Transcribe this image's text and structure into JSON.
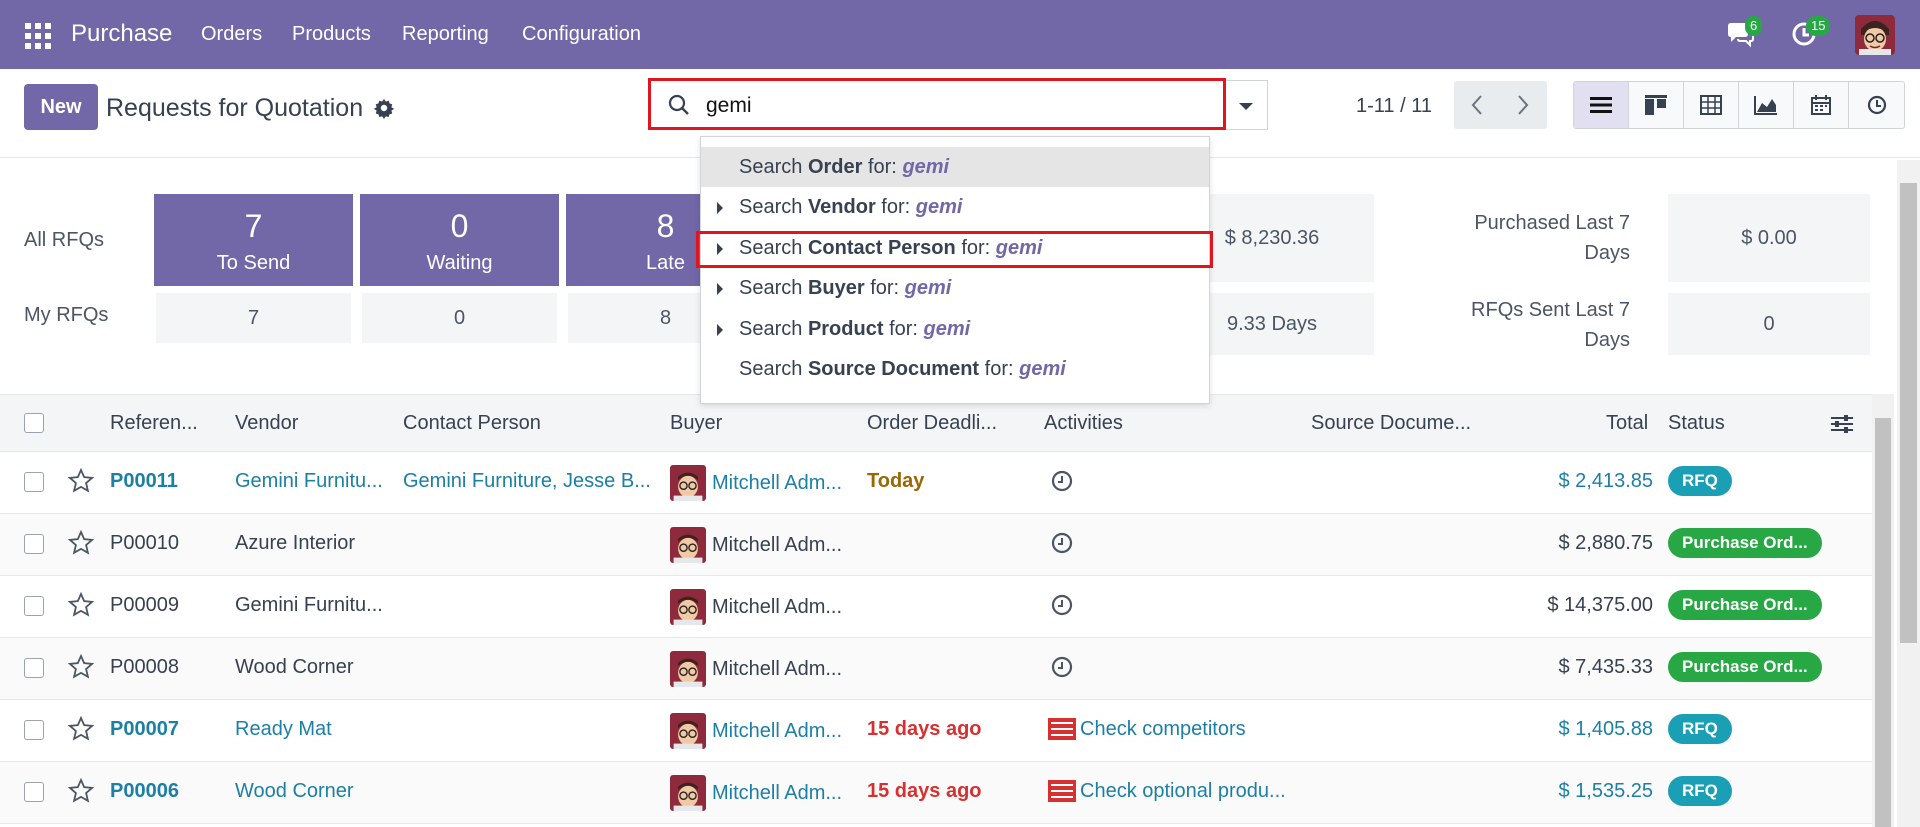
{
  "topbar": {
    "brand": "Purchase",
    "menu": [
      "Orders",
      "Products",
      "Reporting",
      "Configuration"
    ],
    "messages_count": "6",
    "activities_count": "15"
  },
  "control": {
    "new_label": "New",
    "title": "Requests for Quotation",
    "search_value": "gemi",
    "pager": "1-11 / 11"
  },
  "dashboard": {
    "row_all_label": "All RFQs",
    "row_my_label": "My RFQs",
    "tiles": [
      {
        "num": "7",
        "label": "To Send",
        "my": "7"
      },
      {
        "num": "0",
        "label": "Waiting",
        "my": "0"
      },
      {
        "num": "8",
        "label": "Late",
        "my": "8"
      }
    ],
    "stat_value_1": "$ 8,230.36",
    "stat_value_2": "9.33 Days",
    "purchased_label": "Purchased Last 7 Days",
    "purchased_value": "$ 0.00",
    "rfq_sent_label": "RFQs Sent Last 7 Days",
    "rfq_sent_value": "0"
  },
  "search_dropdown": {
    "prefix": "Search",
    "for": "for:",
    "query": "gemi",
    "items": [
      {
        "field": "Order",
        "expandable": false
      },
      {
        "field": "Vendor",
        "expandable": true
      },
      {
        "field": "Contact Person",
        "expandable": true
      },
      {
        "field": "Buyer",
        "expandable": true
      },
      {
        "field": "Product",
        "expandable": true
      },
      {
        "field": "Source Document",
        "expandable": false
      }
    ]
  },
  "table": {
    "headers": {
      "reference": "Referen...",
      "vendor": "Vendor",
      "contact": "Contact Person",
      "buyer": "Buyer",
      "deadline": "Order Deadli...",
      "activities": "Activities",
      "source": "Source Docume...",
      "total": "Total",
      "status": "Status"
    },
    "rows": [
      {
        "ref": "P00011",
        "vendor": "Gemini Furnitu...",
        "contact": "Gemini Furniture, Jesse B...",
        "buyer": "Mitchell Adm...",
        "deadline": "Today",
        "activity": "",
        "total": "$ 2,413.85",
        "status": "RFQ"
      },
      {
        "ref": "P00010",
        "vendor": "Azure Interior",
        "contact": "",
        "buyer": "Mitchell Adm...",
        "deadline": "",
        "activity": "",
        "total": "$ 2,880.75",
        "status": "Purchase Ord..."
      },
      {
        "ref": "P00009",
        "vendor": "Gemini Furnitu...",
        "contact": "",
        "buyer": "Mitchell Adm...",
        "deadline": "",
        "activity": "",
        "total": "$ 14,375.00",
        "status": "Purchase Ord..."
      },
      {
        "ref": "P00008",
        "vendor": "Wood Corner",
        "contact": "",
        "buyer": "Mitchell Adm...",
        "deadline": "",
        "activity": "",
        "total": "$ 7,435.33",
        "status": "Purchase Ord..."
      },
      {
        "ref": "P00007",
        "vendor": "Ready Mat",
        "contact": "",
        "buyer": "Mitchell Adm...",
        "deadline": "15 days ago",
        "activity": "Check competitors",
        "total": "$ 1,405.88",
        "status": "RFQ"
      },
      {
        "ref": "P00006",
        "vendor": "Wood Corner",
        "contact": "",
        "buyer": "Mitchell Adm...",
        "deadline": "15 days ago",
        "activity": "Check optional produ...",
        "total": "$ 1,535.25",
        "status": "RFQ"
      }
    ]
  },
  "colors": {
    "brand": "#7267a7",
    "link": "#1c7fa5",
    "late": "#d63031",
    "today": "#9a6700",
    "rfq_badge": "#1a9fb5",
    "po_badge": "#28a745",
    "highlight_outline": "#e0161e"
  }
}
